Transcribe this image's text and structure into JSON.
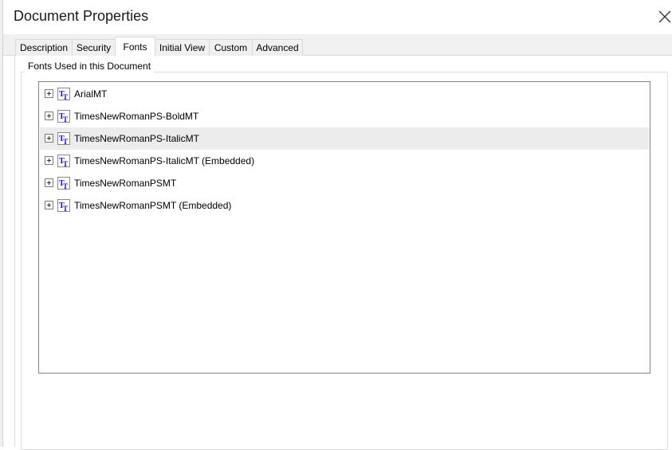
{
  "window": {
    "title": "Document Properties"
  },
  "tabs": [
    {
      "label": "Description"
    },
    {
      "label": "Security"
    },
    {
      "label": "Fonts"
    },
    {
      "label": "Initial View"
    },
    {
      "label": "Custom"
    },
    {
      "label": "Advanced"
    }
  ],
  "active_tab": "Fonts",
  "fonts_group": {
    "label": "Fonts Used in this Document",
    "items": [
      {
        "label": "ArialMT",
        "icon": "truetype-font-icon",
        "expanded": false
      },
      {
        "label": "TimesNewRomanPS-BoldMT",
        "icon": "truetype-font-icon",
        "expanded": false
      },
      {
        "label": "TimesNewRomanPS-ItalicMT",
        "icon": "truetype-font-icon",
        "expanded": false,
        "highlighted": true
      },
      {
        "label": "TimesNewRomanPS-ItalicMT (Embedded)",
        "icon": "truetype-font-icon",
        "expanded": false
      },
      {
        "label": "TimesNewRomanPSMT",
        "icon": "truetype-font-icon",
        "expanded": false
      },
      {
        "label": "TimesNewRomanPSMT (Embedded)",
        "icon": "truetype-font-icon",
        "expanded": false
      }
    ]
  },
  "icons": {
    "close": "close-icon",
    "expander": "plus-expander-icon"
  },
  "colors": {
    "accent": "#1a0dab",
    "selected_row": "#ececec",
    "tab_bg": "#f0f0f0"
  }
}
